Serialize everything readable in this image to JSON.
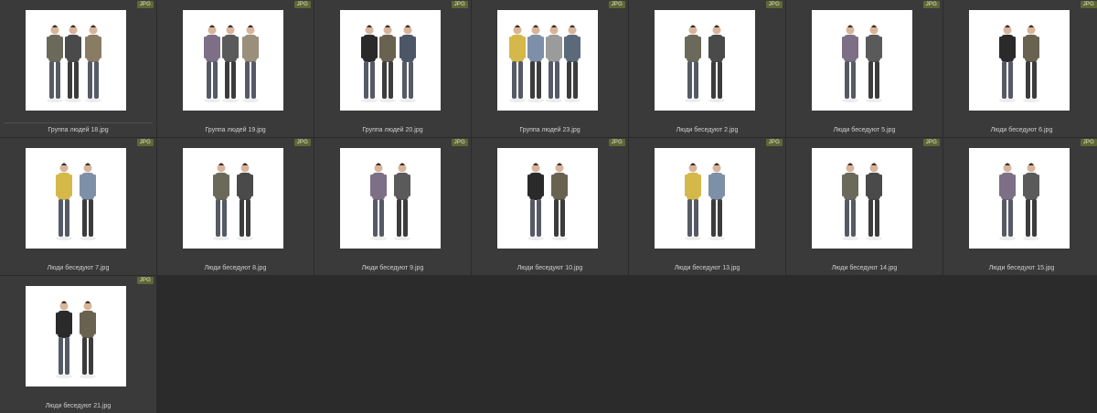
{
  "browser": {
    "items": [
      {
        "name": "Группа людей 18.jpg",
        "badge": "JPG",
        "thumb_icon": "group-photo-icon",
        "figures": 3,
        "selected": true
      },
      {
        "name": "Группа людей 19.jpg",
        "badge": "JPG",
        "thumb_icon": "group-photo-icon",
        "figures": 3
      },
      {
        "name": "Группа людей 20.jpg",
        "badge": "JPG",
        "thumb_icon": "group-photo-icon",
        "figures": 3
      },
      {
        "name": "Группа людей 23.jpg",
        "badge": "JPG",
        "thumb_icon": "group-photo-icon",
        "figures": 4
      },
      {
        "name": "Люди беседуют 2.jpg",
        "badge": "JPG",
        "thumb_icon": "people-talking-photo-icon",
        "figures": 2
      },
      {
        "name": "Люди беседуют 5.jpg",
        "badge": "JPG",
        "thumb_icon": "people-talking-photo-icon",
        "figures": 2
      },
      {
        "name": "Люди беседуют 6.jpg",
        "badge": "JPG",
        "thumb_icon": "people-talking-photo-icon",
        "figures": 2
      },
      {
        "name": "Люди беседуют 7.jpg",
        "badge": "JPG",
        "thumb_icon": "people-talking-photo-icon",
        "figures": 2
      },
      {
        "name": "Люди беседуют 8.jpg",
        "badge": "JPG",
        "thumb_icon": "people-talking-photo-icon",
        "figures": 2
      },
      {
        "name": "Люди беседуют 9.jpg",
        "badge": "JPG",
        "thumb_icon": "people-talking-photo-icon",
        "figures": 2
      },
      {
        "name": "Люди беседуют 10.jpg",
        "badge": "JPG",
        "thumb_icon": "people-talking-photo-icon",
        "figures": 2
      },
      {
        "name": "Люди беседуют 13.jpg",
        "badge": "JPG",
        "thumb_icon": "people-talking-photo-icon",
        "figures": 2
      },
      {
        "name": "Люди беседуют 14.jpg",
        "badge": "JPG",
        "thumb_icon": "people-talking-photo-icon",
        "figures": 2
      },
      {
        "name": "Люди беседуют 15.jpg",
        "badge": "JPG",
        "thumb_icon": "people-talking-photo-icon",
        "figures": 2
      },
      {
        "name": "Люди беседуют 21.jpg",
        "badge": "JPG",
        "thumb_icon": "people-talking-photo-icon",
        "figures": 2
      }
    ]
  }
}
